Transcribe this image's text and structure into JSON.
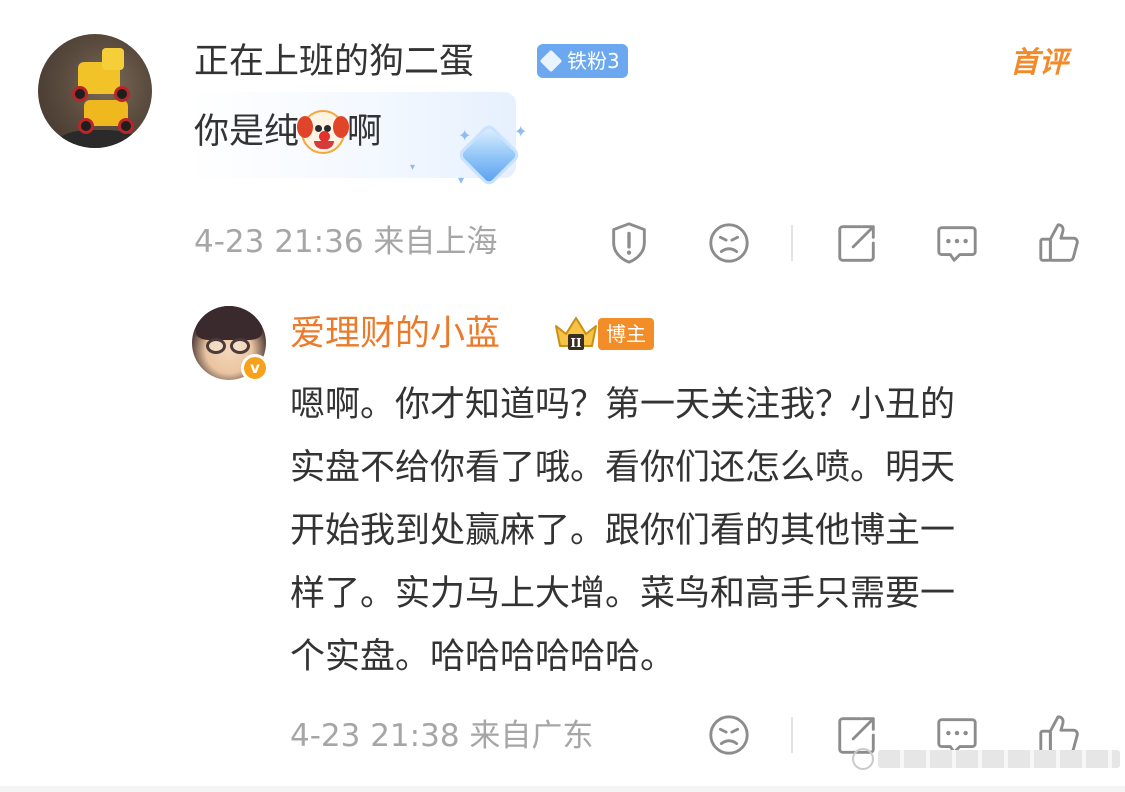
{
  "colors": {
    "username": "#333333",
    "reply_username": "#ec7a2a",
    "meta_text": "#a6a6a6",
    "fan_badge": "#6ba8ef",
    "first_tag": "#f38a2a",
    "blogger_badge": "#f28d28",
    "icon_gray": "#8c8c8c"
  },
  "main_comment": {
    "username": "正在上班的狗二蛋",
    "fan_badge": "铁粉3",
    "first_tag": "首评",
    "text_before": "你是纯",
    "emoji": "clown-face",
    "text_after": "啊",
    "meta": "4-23 21:36 来自上海",
    "actions": [
      "report-icon",
      "dislike-icon",
      "share-icon",
      "reply-icon",
      "like-icon"
    ]
  },
  "reply": {
    "username": "爱理财的小蓝",
    "crown_badge": "crown-icon",
    "blogger_badge": "博主",
    "verified_badge": "v",
    "lines": [
      "嗯啊。你才知道吗？第一天关注我？小丑的",
      "实盘不给你看了哦。看你们还怎么喷。明天",
      "开始我到处赢麻了。跟你们看的其他博主一",
      "样了。实力马上大增。菜鸟和高手只需要一",
      "个实盘。哈哈哈哈哈哈。"
    ],
    "meta": "4-23 21:38 来自广东",
    "actions": [
      "dislike-icon",
      "share-icon",
      "reply-icon",
      "like-icon"
    ]
  }
}
